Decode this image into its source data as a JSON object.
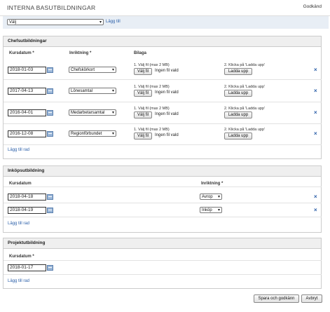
{
  "header": {
    "title": "INTERNA BASUTBILDNINGAR",
    "status": "Godkänd"
  },
  "add_bar": {
    "select_value": "Välj",
    "add_link": "Lägg till"
  },
  "sections": [
    {
      "title": "Chefsutbildningar",
      "col_date": "Kursdatum *",
      "col_direction": "Inriktning *",
      "col_attachment": "Bilaga",
      "rows": [
        {
          "date": "2018-01-03",
          "direction": "Chefskörkort"
        },
        {
          "date": "2017-04-13",
          "direction": "Lönesamtal"
        },
        {
          "date": "2016-04-01",
          "direction": "Medarbetarsamtal"
        },
        {
          "date": "2016-12-08",
          "direction": "Regionförbundet"
        }
      ],
      "add_row": "Lägg till rad"
    },
    {
      "title": "Inköpsutbildning",
      "col_date": "Kursdatum",
      "col_direction": "Inriktning *",
      "rows": [
        {
          "date": "2018-04-18",
          "direction": "Avrop"
        },
        {
          "date": "2018-04-19",
          "direction": "Inköp"
        }
      ],
      "add_row": "Lägg till rad"
    },
    {
      "title": "Projektutbildning",
      "col_date": "Kursdatum *",
      "rows": [
        {
          "date": "2018-01-17"
        }
      ],
      "add_row": "Lägg till rad"
    }
  ],
  "upload": {
    "step1": "1. Välj fil (max 2 MB)",
    "choose_file": "Välj fil",
    "no_file": "Ingen fil vald",
    "step2": "2. Klicka på 'Ladda upp'",
    "upload_btn": "Ladda upp"
  },
  "footer": {
    "save": "Spara och godkänn",
    "cancel": "Avbryt"
  },
  "icons": {
    "delete": "×"
  }
}
